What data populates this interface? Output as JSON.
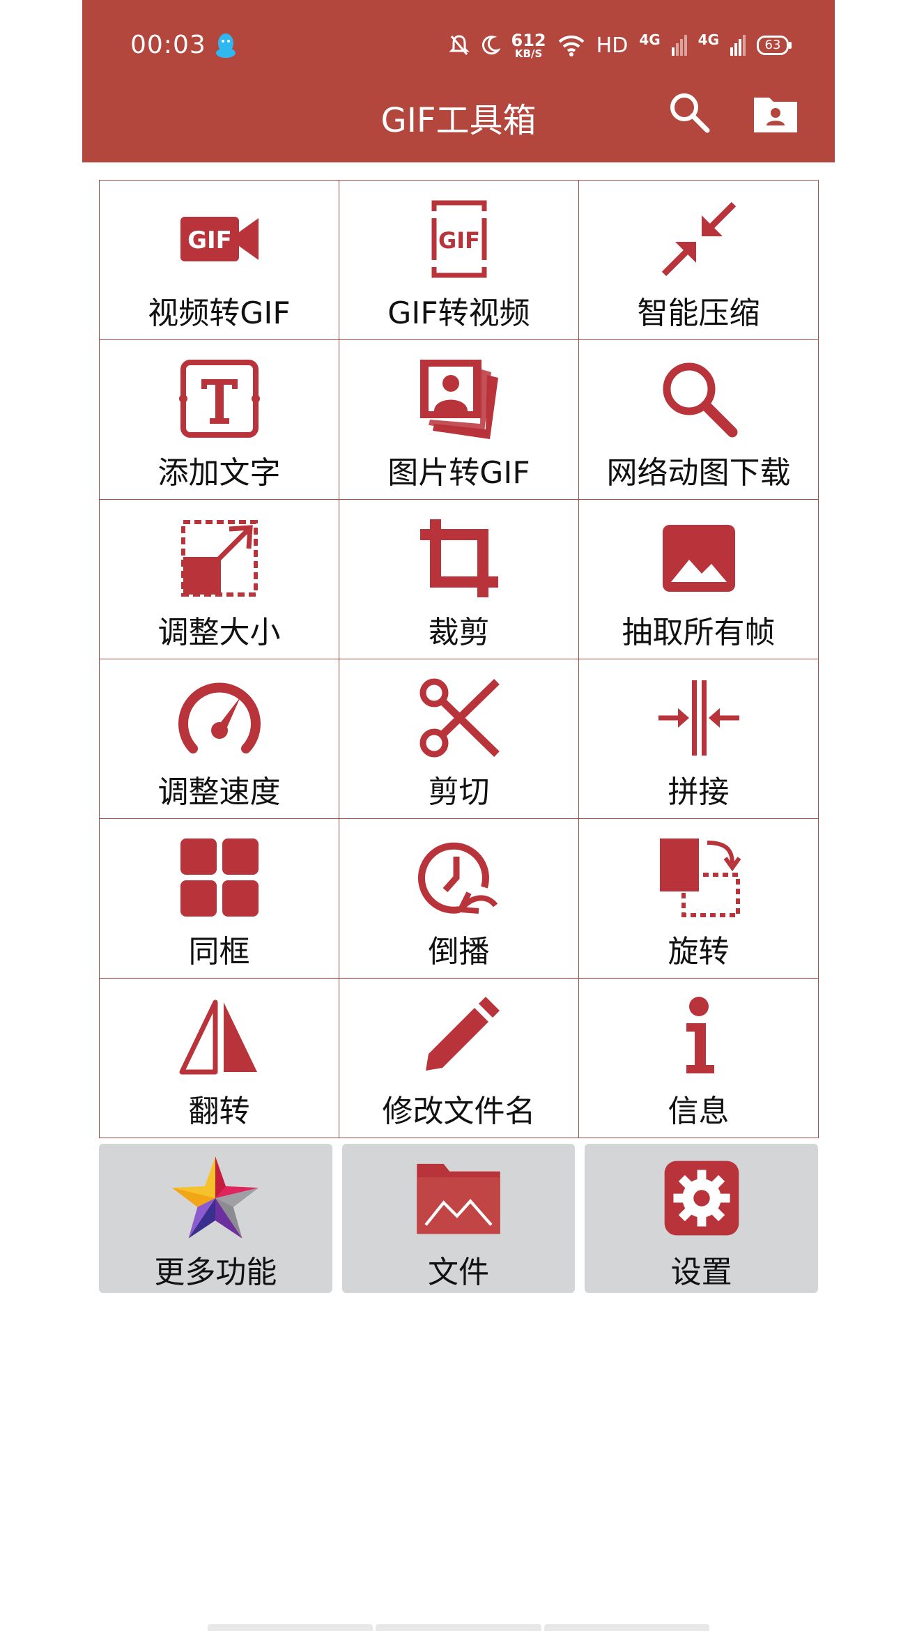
{
  "status_bar": {
    "time": "00:03",
    "speed_value": "612",
    "speed_unit": "KB/S",
    "hd": "HD",
    "net1": "4G",
    "net2": "4G",
    "battery": "63"
  },
  "app_bar": {
    "title": "GIF工具箱"
  },
  "tools": [
    {
      "label": "视频转GIF",
      "icon": "video-to-gif-icon"
    },
    {
      "label": "GIF转视频",
      "icon": "gif-to-video-icon"
    },
    {
      "label": "智能压缩",
      "icon": "compress-arrows-icon"
    },
    {
      "label": "添加文字",
      "icon": "add-text-icon"
    },
    {
      "label": "图片转GIF",
      "icon": "photos-stack-icon"
    },
    {
      "label": "网络动图下载",
      "icon": "search-icon"
    },
    {
      "label": "调整大小",
      "icon": "resize-icon"
    },
    {
      "label": "裁剪",
      "icon": "crop-icon"
    },
    {
      "label": "抽取所有帧",
      "icon": "image-icon"
    },
    {
      "label": "调整速度",
      "icon": "speedometer-icon"
    },
    {
      "label": "剪切",
      "icon": "scissors-icon"
    },
    {
      "label": "拼接",
      "icon": "merge-icon"
    },
    {
      "label": "同框",
      "icon": "grid-icon"
    },
    {
      "label": "倒播",
      "icon": "reverse-clock-icon"
    },
    {
      "label": "旋转",
      "icon": "rotate-icon"
    },
    {
      "label": "翻转",
      "icon": "flip-icon"
    },
    {
      "label": "修改文件名",
      "icon": "pencil-icon"
    },
    {
      "label": "信息",
      "icon": "info-icon"
    }
  ],
  "bottom": {
    "more_label": "更多功能",
    "files_label": "文件",
    "settings_label": "设置"
  },
  "colors": {
    "accent": "#b4473d",
    "icon": "#b8333a",
    "tile_bg": "#d4d5d7"
  }
}
